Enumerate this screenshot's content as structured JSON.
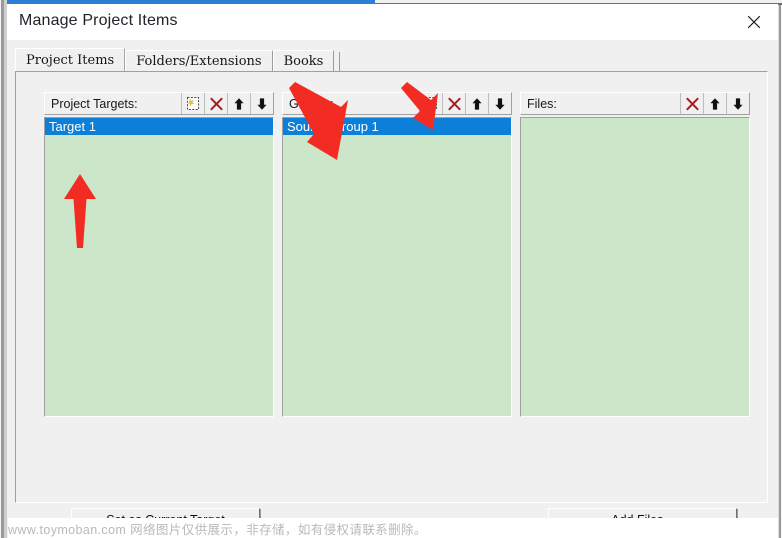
{
  "window": {
    "title": "Manage Project Items",
    "close_icon": "close-icon"
  },
  "tabs": [
    {
      "label": "Project Items",
      "active": true
    },
    {
      "label": "Folders/Extensions",
      "active": false
    },
    {
      "label": "Books",
      "active": false
    }
  ],
  "columns": {
    "targets": {
      "label": "Project Targets:",
      "icons": [
        "new-item-icon",
        "delete-icon",
        "move-up-icon",
        "move-down-icon"
      ],
      "items": [
        {
          "label": "Target 1",
          "selected": true
        }
      ]
    },
    "groups": {
      "label": "Groups:",
      "icons": [
        "new-item-icon",
        "delete-icon",
        "move-up-icon",
        "move-down-icon"
      ],
      "items": [
        {
          "label": "Source Group 1",
          "selected": true
        }
      ]
    },
    "files": {
      "label": "Files:",
      "icons": [
        "delete-icon",
        "move-up-icon",
        "move-down-icon"
      ],
      "items": []
    }
  },
  "buttons": {
    "set_current_target": "Set as Current Target",
    "add_files": "Add Files..."
  },
  "annotations": {
    "arrow_color": "#f22b23",
    "arrows": [
      {
        "name": "arrow-pointing-target-1",
        "direction": "up"
      },
      {
        "name": "arrow-pointing-source-group-1",
        "direction": "down-left"
      },
      {
        "name": "arrow-pointing-new-group-icon",
        "direction": "down-right"
      }
    ]
  },
  "watermark": {
    "text": "www.toymoban.com 网络图片仅供展示，非存储，如有侵权请联系删除。"
  },
  "colors": {
    "selection_blue": "#0c80d8",
    "list_background": "#cbe6c8",
    "dialog_background": "#f0f0f0",
    "accent_blue": "#2d7fd3",
    "delete_icon_red": "#a61c1c"
  }
}
